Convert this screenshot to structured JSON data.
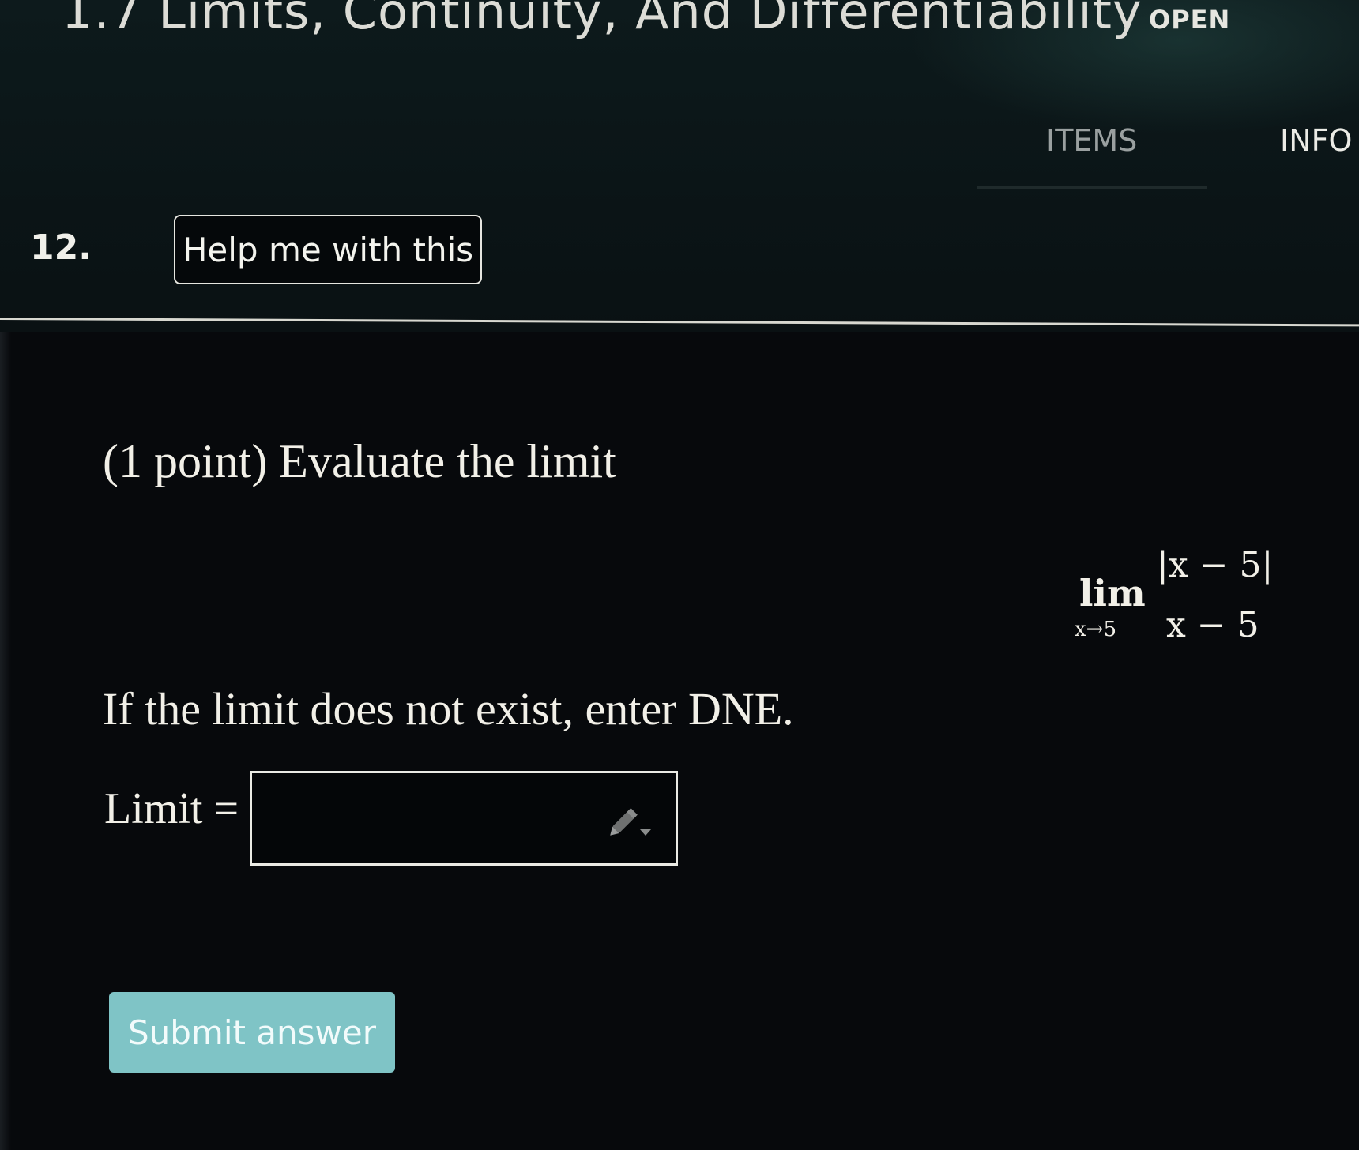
{
  "header": {
    "course_title": "1.7 Limits, Continuity, And Differentiability",
    "status": "OPEN",
    "tabs": [
      {
        "label": "ITEMS"
      },
      {
        "label": "INFO"
      }
    ]
  },
  "question": {
    "number": "12.",
    "help_button_label": "Help me with this",
    "intro": "(1 point) Evaluate the limit",
    "limit": {
      "word": "lim",
      "approach": "x→5",
      "numerator": "|x − 5|",
      "denominator": "x − 5"
    },
    "hint": "If the limit does not exist, enter DNE.",
    "answer_label": "Limit =",
    "answer_value": "",
    "answer_placeholder": "",
    "icons": {
      "input_icon": "pencil-icon"
    },
    "submit_label": "Submit answer"
  },
  "colors": {
    "background": "#07090c",
    "submit_button": "#7fc4c6",
    "text": "#f2f0e8"
  }
}
